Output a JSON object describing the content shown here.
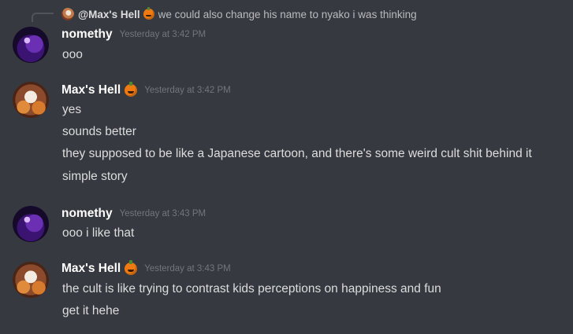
{
  "reply": {
    "user": "@Max's Hell",
    "text": "we could also change his name to nyako i was thinking"
  },
  "messages": [
    {
      "user": "nomethy",
      "timestamp": "Yesterday at 3:42 PM",
      "lines": [
        "ooo"
      ]
    },
    {
      "user": "Max's Hell",
      "timestamp": "Yesterday at 3:42 PM",
      "lines": [
        "yes",
        "sounds better",
        "they supposed to be like a Japanese cartoon, and there's some weird cult shit behind it",
        "simple story"
      ]
    },
    {
      "user": "nomethy",
      "timestamp": "Yesterday at 3:43 PM",
      "lines": [
        "ooo i like that"
      ]
    },
    {
      "user": "Max's Hell",
      "timestamp": "Yesterday at 3:43 PM",
      "lines": [
        "the cult is like trying to contrast kids perceptions on happiness and fun",
        "get it hehe"
      ]
    }
  ]
}
